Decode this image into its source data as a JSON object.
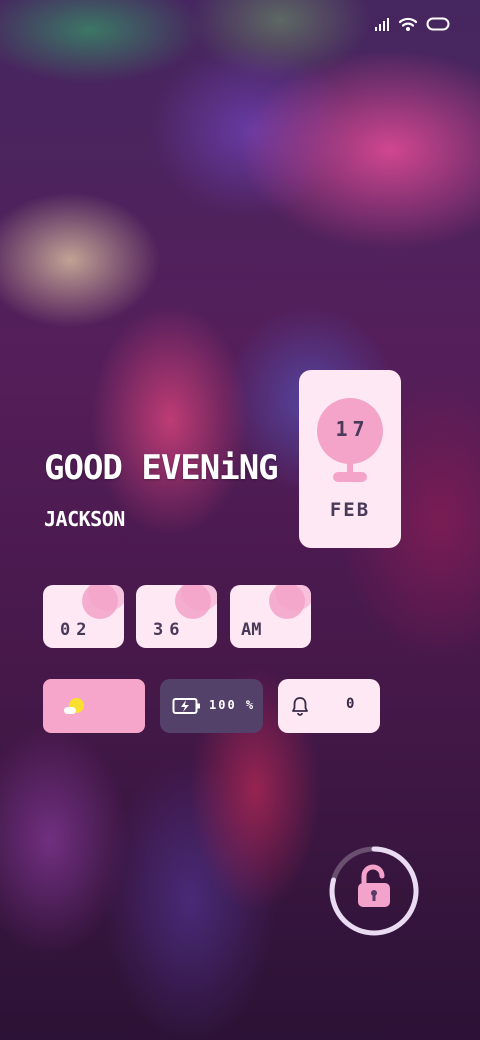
{
  "status_bar": {
    "icons": [
      "signal-icon",
      "wifi-icon",
      "battery-outline-icon"
    ]
  },
  "greeting": {
    "title": "GOOD EVENiNG",
    "name": "JACKSON"
  },
  "date": {
    "day": "17",
    "month": "FEB"
  },
  "time": {
    "hour": "02",
    "minute": "36",
    "period": "AM"
  },
  "widgets": {
    "weather_icon": "partly-sunny-icon",
    "battery_percent": "100 %",
    "battery_icon": "charging-battery-icon",
    "notification_icon": "bell-icon",
    "notification_count": "0"
  },
  "unlock": {
    "icon": "unlock-icon",
    "ring_progress": 0.75
  },
  "colors": {
    "card_light": "#fde8f3",
    "accent_pink": "#f4a3c9",
    "dark_card": "#54416a",
    "text_dark": "#4a3a5a"
  }
}
